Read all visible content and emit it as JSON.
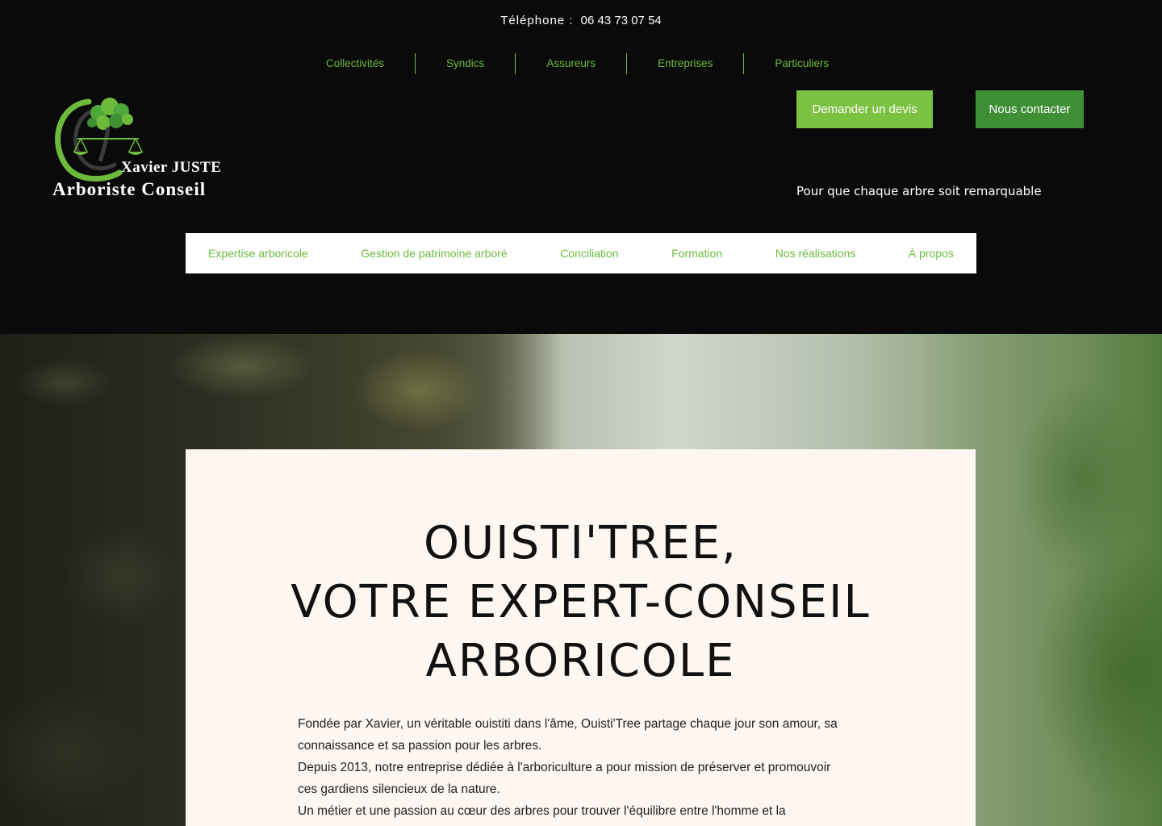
{
  "header": {
    "phone_label": "Téléphone :",
    "phone_number": "06 43 73 07 54",
    "audience_nav": [
      "Collectivités",
      "Syndics",
      "Assureurs",
      "Entreprises",
      "Particuliers"
    ],
    "quote_button": "Demander un devis",
    "contact_button": "Nous contacter",
    "tagline": "Pour que chaque arbre soit remarquable",
    "logo": {
      "line1": "Xavier JUSTE",
      "line2": "Arboriste Conseil"
    },
    "main_nav": [
      "Expertise arboricole",
      "Gestion de patrimoine arboré",
      "Conciliation",
      "Formation",
      "Nos réalisations",
      "À propos"
    ]
  },
  "hero": {
    "title_lines": [
      "OUISTI'TREE,",
      "VOTRE EXPERT-CONSEIL",
      "ARBORICOLE"
    ],
    "paragraphs": [
      "Fondée par Xavier, un véritable ouistiti dans l'âme, Ouisti'Tree partage chaque jour son amour, sa connaissance et sa passion pour les arbres.",
      "Depuis 2013, notre entreprise dédiée à l'arboriculture a pour mission de préserver et promouvoir ces gardiens silencieux de la nature.",
      "Un métier et une passion au cœur des arbres pour trouver l'équilibre entre l'homme et la"
    ]
  },
  "colors": {
    "background": "#0a0a0a",
    "accent_green": "#6dbb3c",
    "button_light_green": "#7bc242",
    "button_dark_green": "#3f8f35",
    "card_background": "#fdf6f1"
  },
  "icons": [
    "tree-scales-logo-icon"
  ]
}
